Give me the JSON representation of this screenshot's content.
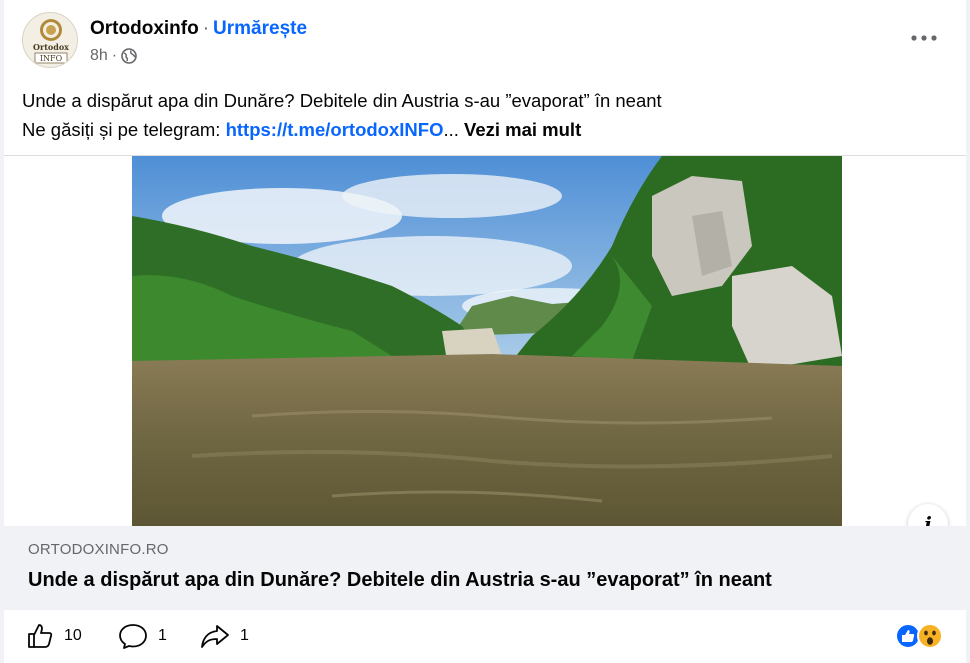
{
  "header": {
    "page_name": "Ortodoxinfo",
    "separator": "·",
    "follow_label": "Urmărește",
    "time": "8h",
    "meta_separator": "·",
    "avatar_text_top": "Ortodox",
    "avatar_text_bottom": "INFO"
  },
  "post": {
    "line1": "Unde a dispărut apa din Dunăre? Debitele din Austria s-au ”evaporat” în neant",
    "line2_prefix": "Ne găsiți și pe telegram: ",
    "line2_link": "https://t.me/ortodoxINFO",
    "line2_ellipsis": "... ",
    "see_more": "Vezi mai mult"
  },
  "link_preview": {
    "domain": "ORTODOXINFO.RO",
    "title": "Unde a dispărut apa din Dunăre? Debitele din Austria s-au ”evaporat” în neant",
    "info_label": "i"
  },
  "actions": {
    "likes": "10",
    "comments": "1",
    "shares": "1"
  },
  "colors": {
    "accent": "#0866ff",
    "secondary_text": "#65676b",
    "link_box_bg": "#f0f2f5"
  },
  "icons": [
    "globe-icon",
    "more-icon",
    "like-icon",
    "comment-icon",
    "share-icon",
    "like-reaction-icon",
    "wow-reaction-icon",
    "info-icon"
  ]
}
